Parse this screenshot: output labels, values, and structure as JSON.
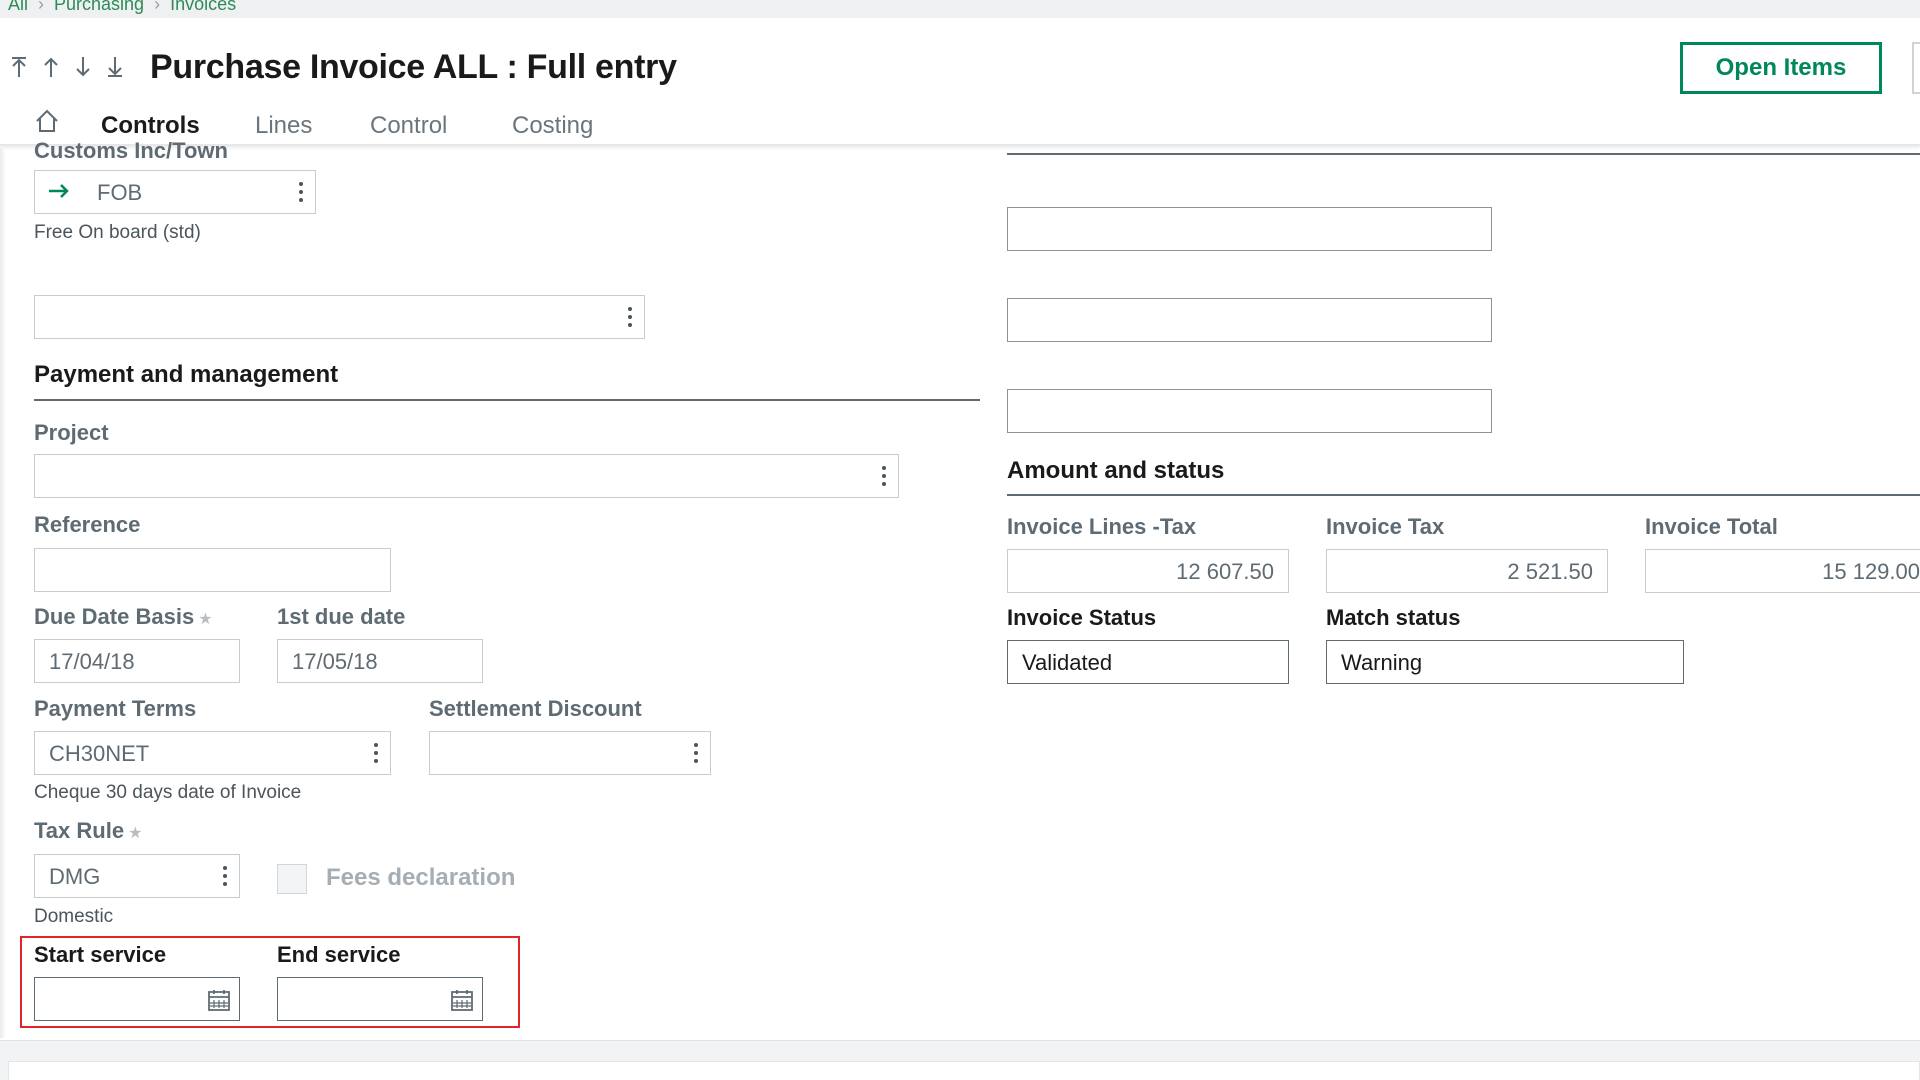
{
  "breadcrumb": {
    "items": [
      "All",
      "Purchasing",
      "Invoices"
    ]
  },
  "header": {
    "title": "Purchase Invoice ALL : Full entry",
    "open_items_label": "Open Items"
  },
  "tabs": [
    {
      "label": "Controls",
      "active": true
    },
    {
      "label": "Lines"
    },
    {
      "label": "Control"
    },
    {
      "label": "Costing"
    }
  ],
  "left": {
    "customs": {
      "label": "Customs Inc/Town",
      "value": "FOB",
      "helper": "Free On board (std)"
    },
    "extra_field_value": "",
    "payment_section": "Payment and management",
    "project": {
      "label": "Project",
      "value": ""
    },
    "reference": {
      "label": "Reference",
      "value": ""
    },
    "due_date_basis": {
      "label": "Due Date Basis",
      "value": "17/04/18"
    },
    "first_due_date": {
      "label": "1st due date",
      "value": "17/05/18"
    },
    "payment_terms": {
      "label": "Payment Terms",
      "value": "CH30NET",
      "helper": "Cheque 30 days date of Invoice"
    },
    "settlement_discount": {
      "label": "Settlement Discount",
      "value": ""
    },
    "tax_rule": {
      "label": "Tax Rule",
      "value": "DMG",
      "helper": "Domestic"
    },
    "fees_declaration": {
      "label": "Fees declaration",
      "checked": false
    },
    "start_service": {
      "label": "Start service",
      "value": ""
    },
    "end_service": {
      "label": "End service",
      "value": ""
    }
  },
  "right": {
    "empty_fields": [
      "",
      "",
      ""
    ],
    "amount_section": "Amount and status",
    "invoice_lines_tax": {
      "label": "Invoice Lines -Tax",
      "value": "12 607.50"
    },
    "invoice_tax": {
      "label": "Invoice Tax",
      "value": "2 521.50"
    },
    "invoice_total": {
      "label": "Invoice Total",
      "value": "15 129.00"
    },
    "invoice_status": {
      "label": "Invoice Status",
      "value": "Validated"
    },
    "match_status": {
      "label": "Match status",
      "value": "Warning"
    }
  },
  "colors": {
    "accent": "#00875a",
    "highlight": "#e0242a"
  },
  "icons": [
    "first-record-icon",
    "previous-record-icon",
    "next-record-icon",
    "last-record-icon",
    "home-icon",
    "arrow-right-icon",
    "kebab-menu-icon",
    "calendar-icon"
  ]
}
